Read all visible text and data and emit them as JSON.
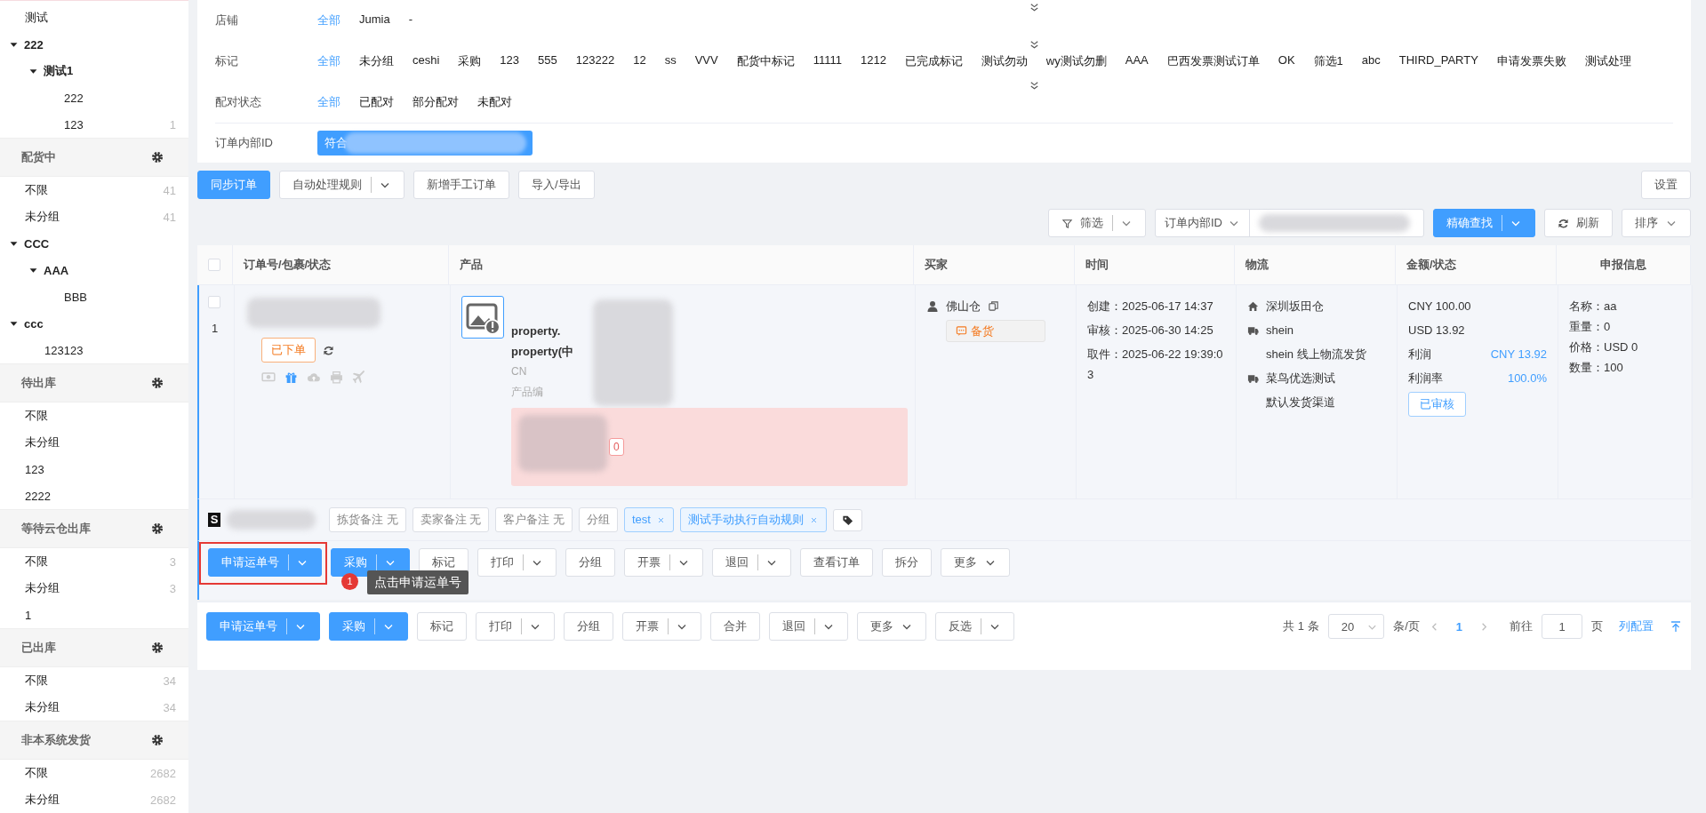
{
  "sidebar": {
    "top_items": [
      {
        "label": "测试"
      },
      {
        "label": "222",
        "expanded": true,
        "children": [
          {
            "label": "测试1",
            "expanded": true,
            "children": [
              {
                "label": "222"
              },
              {
                "label": "123",
                "count": "1"
              }
            ]
          }
        ]
      }
    ],
    "sections": [
      {
        "title": "配货中",
        "items": [
          {
            "label": "不限",
            "count": "41"
          },
          {
            "label": "未分组",
            "count": "41"
          },
          {
            "label": "CCC",
            "expanded": true,
            "children": [
              {
                "label": "AAA",
                "expanded": true,
                "children": [
                  {
                    "label": "BBB"
                  }
                ]
              }
            ]
          },
          {
            "label": "ccc",
            "expanded": true,
            "children": [
              {
                "label": "123123"
              }
            ]
          }
        ]
      },
      {
        "title": "待出库",
        "items": [
          {
            "label": "不限"
          },
          {
            "label": "未分组"
          },
          {
            "label": "123"
          },
          {
            "label": "2222"
          }
        ]
      },
      {
        "title": "等待云仓出库",
        "items": [
          {
            "label": "不限",
            "count": "3"
          },
          {
            "label": "未分组",
            "count": "3"
          },
          {
            "label": "1"
          }
        ]
      },
      {
        "title": "已出库",
        "items": [
          {
            "label": "不限",
            "count": "34"
          },
          {
            "label": "未分组",
            "count": "34"
          }
        ]
      },
      {
        "title": "非本系统发货",
        "items": [
          {
            "label": "不限",
            "count": "2682"
          },
          {
            "label": "未分组",
            "count": "2682"
          }
        ]
      }
    ]
  },
  "filters": [
    {
      "label": "店铺",
      "options": [
        {
          "label": "全部",
          "selected": true
        },
        {
          "label": "Jumia",
          "selected": false
        },
        {
          "label": "-",
          "selected": false
        }
      ]
    },
    {
      "label": "标记",
      "options": [
        {
          "label": "全部",
          "selected": true
        },
        {
          "label": "未分组",
          "selected": false
        },
        {
          "label": "ceshi",
          "selected": false
        },
        {
          "label": "采购",
          "selected": false
        },
        {
          "label": "123",
          "selected": false
        },
        {
          "label": "555",
          "selected": false
        },
        {
          "label": "123222",
          "selected": false
        },
        {
          "label": "12",
          "selected": false
        },
        {
          "label": "ss",
          "selected": false
        },
        {
          "label": "VVV",
          "selected": false
        },
        {
          "label": "配货中标记",
          "selected": false
        },
        {
          "label": "11111",
          "selected": false
        },
        {
          "label": "1212",
          "selected": false
        },
        {
          "label": "已完成标记",
          "selected": false
        },
        {
          "label": "测试勿动",
          "selected": false
        },
        {
          "label": "wy测试勿删",
          "selected": false
        },
        {
          "label": "AAA",
          "selected": false
        },
        {
          "label": "巴西发票测试订单",
          "selected": false
        },
        {
          "label": "OK",
          "selected": false
        },
        {
          "label": "筛选1",
          "selected": false
        },
        {
          "label": "abc",
          "selected": false
        },
        {
          "label": "THIRD_PARTY",
          "selected": false
        },
        {
          "label": "申请发票失败",
          "selected": false
        },
        {
          "label": "测试处理",
          "selected": false
        }
      ]
    },
    {
      "label": "配对状态",
      "options": [
        {
          "label": "全部",
          "selected": true
        },
        {
          "label": "已配对",
          "selected": false
        },
        {
          "label": "部分配对",
          "selected": false
        },
        {
          "label": "未配对",
          "selected": false
        }
      ]
    }
  ],
  "order_id_filter": {
    "label": "订单内部ID",
    "chip": "符合"
  },
  "toolbar": {
    "buttons": [
      {
        "label": "同步订单",
        "kind": "primary"
      },
      {
        "label": "自动处理规则",
        "kind": "split"
      },
      {
        "label": "新增手工订单",
        "kind": "plain"
      },
      {
        "label": "导入/导出",
        "kind": "plain"
      }
    ],
    "settings": "设置"
  },
  "search_bar": {
    "filter": "筛选",
    "field_type": "订单内部ID",
    "search": "精确查找",
    "refresh": "刷新",
    "sort": "排序"
  },
  "table": {
    "select_all": {
      "checked": false
    },
    "columns": [
      "订单号/包裹/状态",
      "产品",
      "买家",
      "时间",
      "物流",
      "金额/状态",
      "申报信息"
    ],
    "rows": [
      {
        "checked": false,
        "index": "1",
        "status": "已下单",
        "product": {
          "lines": [
            {
              "text": "property.",
              "kind": "attribute"
            },
            {
              "text": "property(中",
              "kind": "attribute"
            },
            {
              "text": "CN",
              "kind": "meta"
            },
            {
              "text": "产品编",
              "kind": "meta"
            }
          ],
          "alert_tag": "0"
        },
        "buyer": {
          "name": "佛山仓",
          "note": "备货"
        },
        "times": [
          "创建：2025-06-17 14:37",
          "审核：2025-06-30 14:25",
          "取件：2025-06-22 19:39:03"
        ],
        "logistics": [
          {
            "kind": "warehouse",
            "name": "深圳坂田仓"
          },
          {
            "kind": "carrier",
            "name": "shein",
            "channel": "shein 线上物流发货"
          },
          {
            "kind": "carrier",
            "name": "菜鸟优选测试",
            "channel": "默认发货渠道"
          }
        ],
        "amounts": [
          "CNY 100.00",
          "USD 13.92"
        ],
        "profit": {
          "label": "利润",
          "value": "CNY 13.92"
        },
        "margin": {
          "label": "利润率",
          "value": "100.0%"
        },
        "review": "已审核",
        "declaration": [
          "名称：aa",
          "重量：0",
          "价格：USD 0",
          "数量：100"
        ],
        "store_mark": "S",
        "notes": [
          "拣货备注 无",
          "卖家备注 无",
          "客户备注 无",
          "分组"
        ],
        "labels": [
          "test",
          "测试手动执行自动规则"
        ]
      }
    ]
  },
  "row_actions": [
    {
      "label": "申请运单号",
      "kind": "primary-split"
    },
    {
      "label": "采购",
      "kind": "primary-split"
    },
    {
      "label": "标记",
      "kind": "plain"
    },
    {
      "label": "打印",
      "kind": "split"
    },
    {
      "label": "分组",
      "kind": "plain"
    },
    {
      "label": "开票",
      "kind": "split"
    },
    {
      "label": "退回",
      "kind": "split"
    },
    {
      "label": "查看订单",
      "kind": "plain"
    },
    {
      "label": "拆分",
      "kind": "plain"
    },
    {
      "label": "更多",
      "kind": "dropdown"
    }
  ],
  "guide": {
    "step": "1",
    "text": "点击申请运单号"
  },
  "footer": {
    "buttons": [
      {
        "label": "申请运单号",
        "kind": "primary-split"
      },
      {
        "label": "采购",
        "kind": "primary-split"
      },
      {
        "label": "标记",
        "kind": "plain"
      },
      {
        "label": "打印",
        "kind": "split"
      },
      {
        "label": "分组",
        "kind": "plain"
      },
      {
        "label": "开票",
        "kind": "split"
      },
      {
        "label": "合并",
        "kind": "plain"
      },
      {
        "label": "退回",
        "kind": "split"
      },
      {
        "label": "更多",
        "kind": "dropdown"
      },
      {
        "label": "反选",
        "kind": "split"
      }
    ],
    "total": "共 1 条",
    "page_size": "20",
    "per_page": "条/页",
    "pages": [
      {
        "label": "1",
        "selected": true
      }
    ],
    "goto_label": "前往",
    "goto_value": "1",
    "page_unit": "页",
    "column_config": "列配置"
  }
}
